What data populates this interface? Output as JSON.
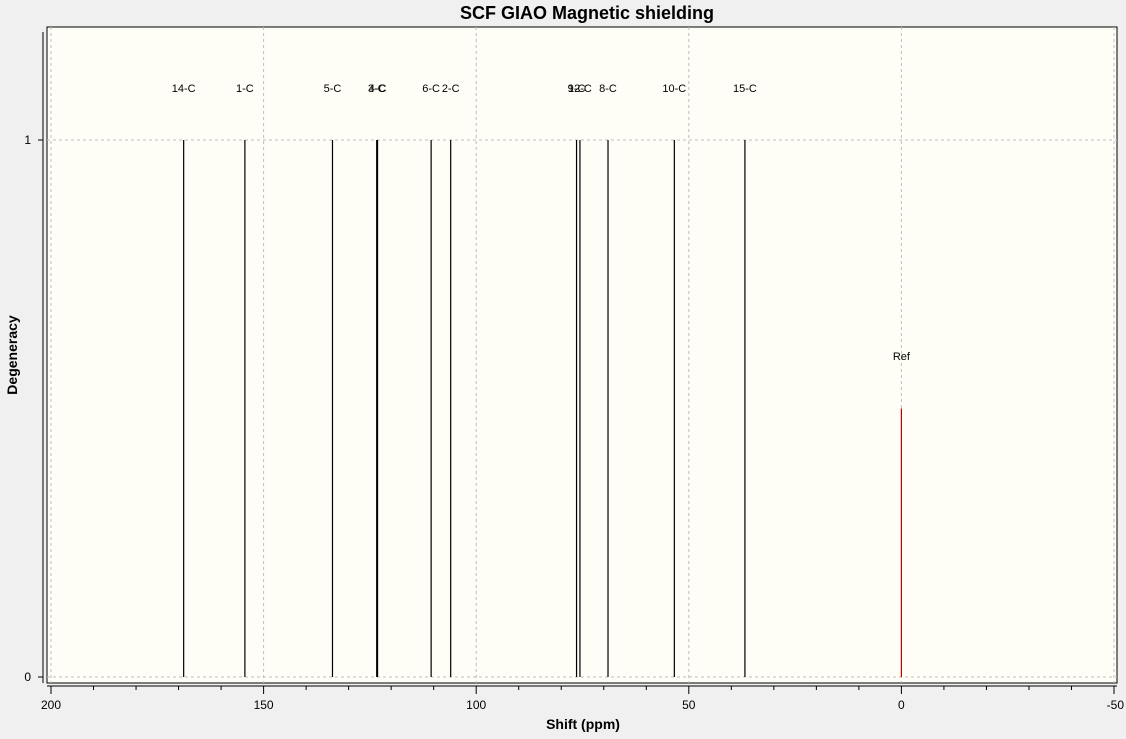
{
  "chart_data": {
    "type": "bar",
    "title": "SCF GIAO Magnetic shielding",
    "xlabel": "Shift (ppm)",
    "ylabel": "Degeneracy",
    "xlim": [
      200,
      -50
    ],
    "ylim": [
      0,
      1.2
    ],
    "x_ticks": [
      200,
      150,
      100,
      50,
      0,
      -50
    ],
    "y_ticks": [
      0,
      1
    ],
    "grid": true,
    "colors": {
      "plot_bg": "#fefef6",
      "frame_bg": "#f0f0f0",
      "peak": "#000000",
      "ref": "#c00000",
      "grid": "#bdbdbd"
    },
    "series": [
      {
        "points": [
          {
            "x": 168.8,
            "y": 1,
            "label": "14-C"
          },
          {
            "x": 154.4,
            "y": 1,
            "label": "1-C"
          },
          {
            "x": 133.8,
            "y": 1,
            "label": "5-C"
          },
          {
            "x": 123.4,
            "y": 1,
            "label": "3-C"
          },
          {
            "x": 123.2,
            "y": 1,
            "label": "4-C"
          },
          {
            "x": 110.6,
            "y": 1,
            "label": "6-C"
          },
          {
            "x": 106.0,
            "y": 1,
            "label": "2-C"
          },
          {
            "x": 76.4,
            "y": 1,
            "label": "9-C"
          },
          {
            "x": 75.6,
            "y": 1,
            "label": "12-C"
          },
          {
            "x": 69.0,
            "y": 1,
            "label": "8-C"
          },
          {
            "x": 53.4,
            "y": 1,
            "label": "10-C"
          },
          {
            "x": 36.8,
            "y": 1,
            "label": "15-C"
          }
        ]
      },
      {
        "points": [
          {
            "x": 0,
            "y": 0.5,
            "label": "Ref"
          }
        ]
      }
    ]
  }
}
